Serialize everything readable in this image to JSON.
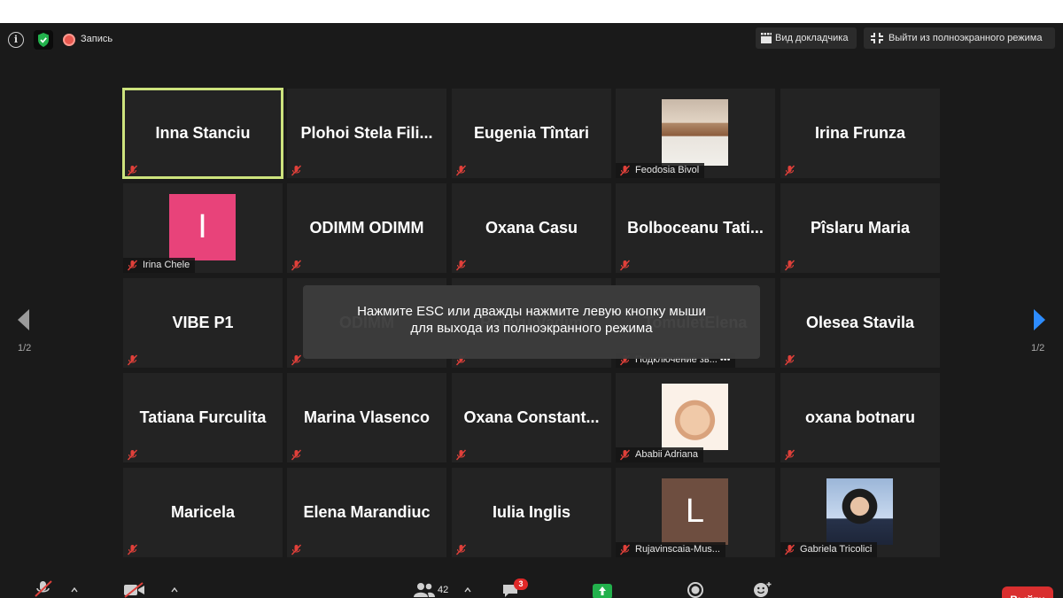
{
  "top_bar": {
    "recording_label": "Запись",
    "speaker_view_label": "Вид докладчика",
    "exit_fullscreen_label": "Выйти из полноэкранного режима"
  },
  "tiles": [
    {
      "kind": "name",
      "name": "Inna Stanciu",
      "active": true
    },
    {
      "kind": "name",
      "name": "Plohoi  Stela  Fili..."
    },
    {
      "kind": "name",
      "name": "Eugenia Tîntari"
    },
    {
      "kind": "photo",
      "label": "Feodosia Bivol",
      "photo": "photo-lady1"
    },
    {
      "kind": "name",
      "name": "Irina Frunza"
    },
    {
      "kind": "letter",
      "letter": "I",
      "color": "#e8437a",
      "label": "Irina Chele"
    },
    {
      "kind": "name",
      "name": "ODIMM ODIMM"
    },
    {
      "kind": "name",
      "name": "Oxana Casu"
    },
    {
      "kind": "name",
      "name": "Bolboceanu  Tati..."
    },
    {
      "kind": "name",
      "name": "Pîslaru Maria"
    },
    {
      "kind": "name",
      "name": "VIBE P1"
    },
    {
      "kind": "name",
      "name": "ODIMM"
    },
    {
      "kind": "name",
      "name": "Rotaru Vadim"
    },
    {
      "kind": "name",
      "name": "TomuletElena",
      "label": "Подключение зв...  •••"
    },
    {
      "kind": "name",
      "name": "Olesea Stavila"
    },
    {
      "kind": "name",
      "name": "Tatiana  Furculita"
    },
    {
      "kind": "name",
      "name": "Marina Vlasenco"
    },
    {
      "kind": "name",
      "name": "Oxana  Constant..."
    },
    {
      "kind": "photo",
      "label": "Ababii Adriana",
      "photo": "photo-baby"
    },
    {
      "kind": "name",
      "name": "oxana botnaru"
    },
    {
      "kind": "name",
      "name": "Maricela"
    },
    {
      "kind": "name",
      "name": "Elena Marandiuc"
    },
    {
      "kind": "name",
      "name": "Iulia Inglis"
    },
    {
      "kind": "letter",
      "letter": "L",
      "color": "#6e4e40",
      "label": "Rujavinscaia-Mus..."
    },
    {
      "kind": "photo",
      "label": "Gabriela Tricolici",
      "photo": "photo-lady2"
    }
  ],
  "overlay": {
    "line1": "Нажмите ESC или дважды нажмите левую кнопку мыши",
    "line2": "для выхода из полноэкранного режима"
  },
  "pagination": {
    "left": "1/2",
    "right": "1/2"
  },
  "bottom_bar": {
    "participants_count": "42",
    "chat_badge": "3",
    "end_label": "Выйти"
  },
  "colors": {
    "active_outline": "#cde37d",
    "mute_red": "#e0403a",
    "nav_right": "#2d8cff",
    "share_green": "#22b14c",
    "end_red": "#d92f2f"
  }
}
